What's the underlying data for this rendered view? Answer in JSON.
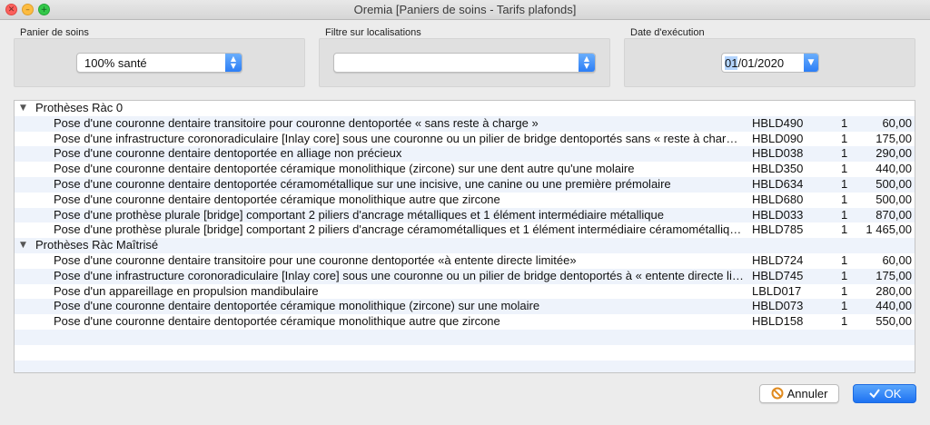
{
  "window": {
    "title": "Oremia [Paniers de soins - Tarifs plafonds]"
  },
  "filters": {
    "panier_label": "Panier de soins",
    "panier_value": "100% santé",
    "localisation_label": "Filtre sur localisations",
    "localisation_value": "",
    "date_label": "Date d'exécution",
    "date_selected": "01",
    "date_rest": "/01/2020"
  },
  "groups": [
    {
      "title": "Prothèses Ràc 0",
      "rows": [
        {
          "libelle": "Pose d'une couronne dentaire transitoire pour couronne dentoportée « sans reste à charge »",
          "code": "HBLD490",
          "qty": "1",
          "price": "60,00"
        },
        {
          "libelle": "Pose d'une infrastructure coronoradiculaire [Inlay core] sous une couronne ou un pilier de bridge dentoportés sans « reste à charge »",
          "code": "HBLD090",
          "qty": "1",
          "price": "175,00"
        },
        {
          "libelle": "Pose d'une couronne dentaire dentoportée en alliage non précieux",
          "code": "HBLD038",
          "qty": "1",
          "price": "290,00"
        },
        {
          "libelle": "Pose d'une couronne dentaire dentoportée céramique monolithique (zircone) sur une dent autre qu'une molaire",
          "code": "HBLD350",
          "qty": "1",
          "price": "440,00"
        },
        {
          "libelle": "Pose d'une couronne dentaire dentoportée céramométallique sur une incisive, une canine ou une première prémolaire",
          "code": "HBLD634",
          "qty": "1",
          "price": "500,00"
        },
        {
          "libelle": "Pose d'une couronne dentaire dentoportée céramique monolithique autre que zircone",
          "code": "HBLD680",
          "qty": "1",
          "price": "500,00"
        },
        {
          "libelle": "Pose d'une prothèse plurale [bridge] comportant 2 piliers d'ancrage métalliques et 1 élément intermédiaire métallique",
          "code": "HBLD033",
          "qty": "1",
          "price": "870,00"
        },
        {
          "libelle": "Pose d'une prothèse plurale [bridge] comportant 2 piliers d'ancrage céramométalliques et 1 élément intermédiaire céramométallique …",
          "code": "HBLD785",
          "qty": "1",
          "price": "1 465,00"
        }
      ]
    },
    {
      "title": "Prothèses Ràc Maîtrisé",
      "rows": [
        {
          "libelle": "Pose d'une couronne dentaire transitoire pour une couronne dentoportée «à entente directe limitée»",
          "code": "HBLD724",
          "qty": "1",
          "price": "60,00"
        },
        {
          "libelle": "Pose d'une infrastructure coronoradiculaire [Inlay core] sous une couronne ou un pilier de bridge dentoportés à « entente directe lim…",
          "code": "HBLD745",
          "qty": "1",
          "price": "175,00"
        },
        {
          "libelle": "Pose d'un appareillage en propulsion mandibulaire",
          "code": "LBLD017",
          "qty": "1",
          "price": "280,00"
        },
        {
          "libelle": "Pose d'une couronne dentaire dentoportée céramique monolithique (zircone) sur une molaire",
          "code": "HBLD073",
          "qty": "1",
          "price": "440,00"
        },
        {
          "libelle": "Pose d'une couronne dentaire dentoportée céramique monolithique  autre que zircone",
          "code": "HBLD158",
          "qty": "1",
          "price": "550,00"
        }
      ]
    }
  ],
  "buttons": {
    "cancel_label": "Annuler",
    "ok_label": "OK"
  },
  "colors": {
    "accent": "#2c7ef6",
    "row_alt": "#eef3fb"
  },
  "icons": {
    "close": "close-icon",
    "minimize": "minimize-icon",
    "zoom": "zoom-icon",
    "cancel": "prohibited-icon",
    "ok": "checkmark-icon"
  }
}
